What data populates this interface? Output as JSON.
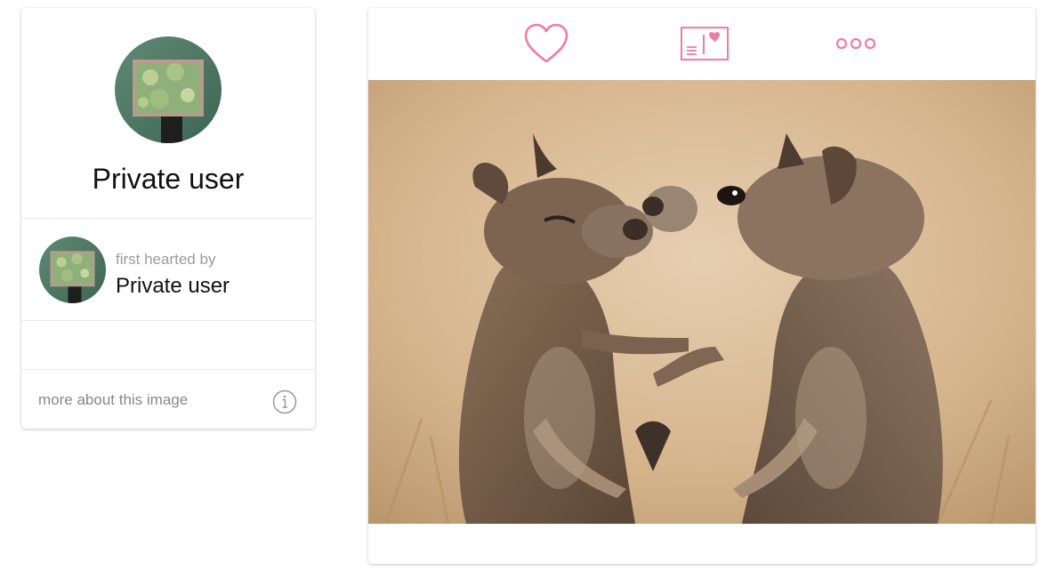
{
  "profile": {
    "name": "Private user",
    "avatar_icon": "user-avatar-photo"
  },
  "first_hearted": {
    "label": "first hearted by",
    "user": "Private user"
  },
  "more_about": {
    "label": "more about this image",
    "icon": "info-icon"
  },
  "toolbar": {
    "heart_icon": "heart-icon",
    "save_icon": "save-to-collection-icon",
    "more_icon": "more-options-icon"
  },
  "colors": {
    "accent": "#f07ba6",
    "muted_text": "#9a9a9a",
    "divider": "#e9e9e9"
  },
  "image": {
    "subject": "squirrel-pair-photo"
  }
}
